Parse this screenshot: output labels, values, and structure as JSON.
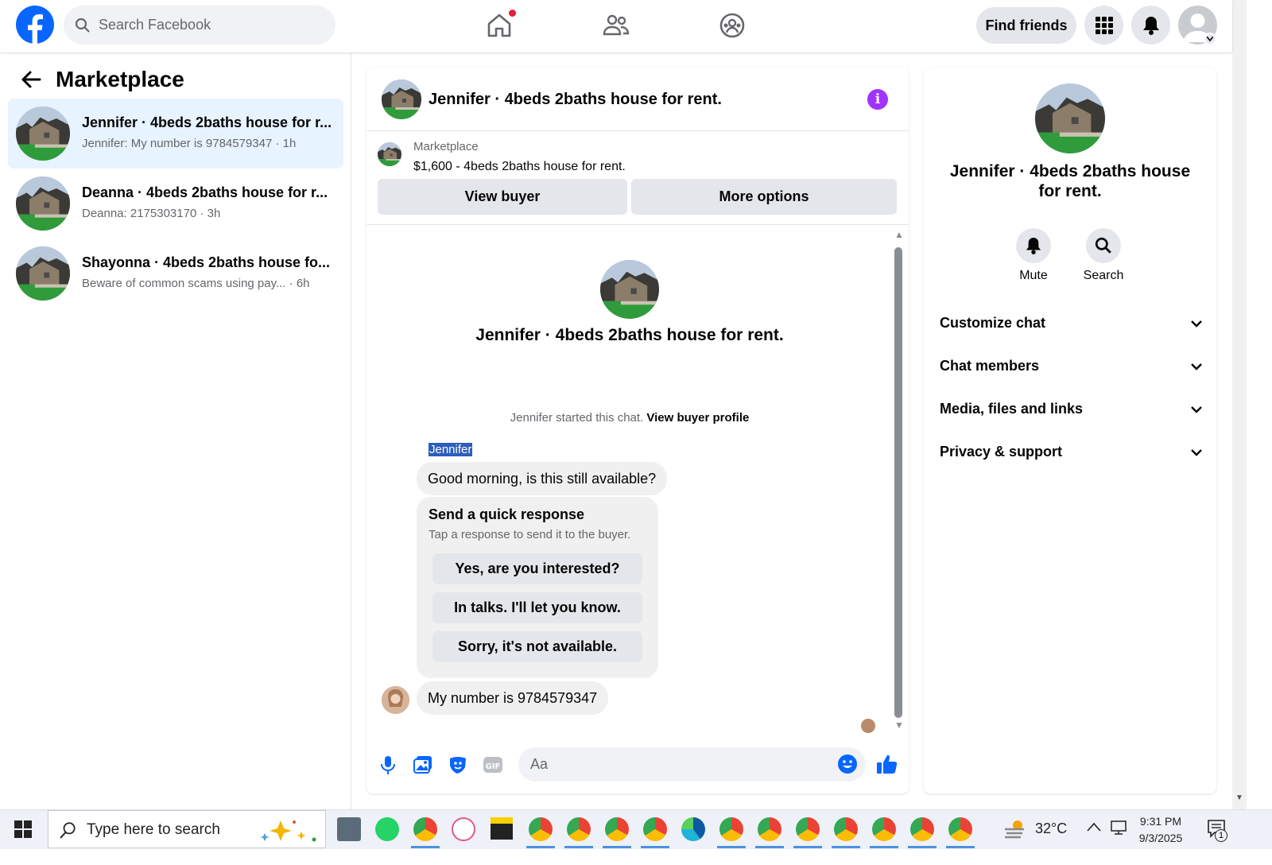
{
  "topbar": {
    "search_placeholder": "Search Facebook",
    "find_friends": "Find friends",
    "brand_color": "#0866ff"
  },
  "left": {
    "title": "Marketplace",
    "conversations": [
      {
        "title": "Jennifer · 4beds 2baths house for r...",
        "snippet": "Jennifer: My number is 9784579347 · 1h",
        "selected": true
      },
      {
        "title": "Deanna · 4beds 2baths house for r...",
        "snippet": "Deanna: 2175303170 · 3h",
        "selected": false
      },
      {
        "title": "Shayonna · 4beds 2baths house fo...",
        "snippet": "Beware of common scams using pay...   · 6h",
        "selected": false
      }
    ]
  },
  "chat": {
    "title": "Jennifer · 4beds 2baths house for rent.",
    "marketplace_label": "Marketplace",
    "listing": "$1,600 - 4beds 2baths house for rent.",
    "view_buyer": "View buyer",
    "more_options": "More options",
    "center_title": "Jennifer · 4beds 2baths house for rent.",
    "started_text": "Jennifer started this chat.",
    "view_buyer_profile": "View buyer profile",
    "sender_name": "Jennifer",
    "message1": "Good morning, is this still available?",
    "quick_title": "Send a quick response",
    "quick_sub": "Tap a response to send it to the buyer.",
    "quick_responses": [
      "Yes, are you interested?",
      "In talks. I'll let you know.",
      "Sorry, it's not available."
    ],
    "message2": "My number is 9784579347",
    "composer_placeholder": "Aa"
  },
  "right": {
    "title": "Jennifer · 4beds 2baths house for rent.",
    "mute": "Mute",
    "search": "Search",
    "sections": [
      "Customize chat",
      "Chat members",
      "Media, files and links",
      "Privacy & support"
    ]
  },
  "taskbar": {
    "search_placeholder": "Type here to search",
    "temperature": "32°C",
    "time": "9:31 PM",
    "date": "9/3/2025",
    "notification_count": "1"
  }
}
